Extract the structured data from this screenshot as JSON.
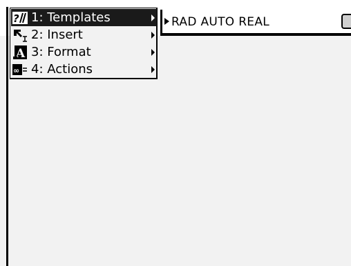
{
  "status_bar": {
    "mode_text": "RAD AUTO REAL"
  },
  "menu": {
    "items": [
      {
        "label": "1: Templates",
        "icon": "templates-icon",
        "selected": true
      },
      {
        "label": "2: Insert",
        "icon": "insert-icon",
        "selected": false
      },
      {
        "label": "3: Format",
        "icon": "format-icon",
        "selected": false
      },
      {
        "label": "4: Actions",
        "icon": "actions-icon",
        "selected": false
      }
    ]
  },
  "colors": {
    "highlight": "#1a1a1a",
    "background": "#f2f2f2",
    "text": "#000000"
  }
}
